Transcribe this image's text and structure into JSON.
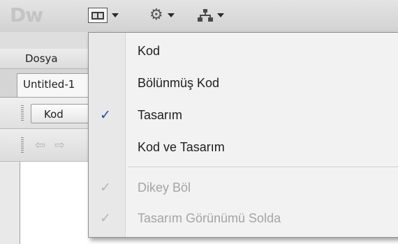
{
  "app": {
    "logo": "Dw"
  },
  "menubar": {
    "file": "Dosya"
  },
  "document": {
    "tab_title": "Untitled-1"
  },
  "doc_toolbar": {
    "code_label": "Kod"
  },
  "nav": {
    "back_icon": "left-arrow-icon",
    "forward_icon": "right-arrow-icon"
  },
  "toolbar": {
    "layout_icon": "layout-split-icon",
    "gear_icon": "gear-icon",
    "site_icon": "sitemap-icon"
  },
  "view_menu": {
    "items": [
      {
        "label": "Kod",
        "checked": false,
        "enabled": true
      },
      {
        "label": "Bölünmüş Kod",
        "checked": false,
        "enabled": true
      },
      {
        "label": "Tasarım",
        "checked": true,
        "enabled": true
      },
      {
        "label": "Kod ve Tasarım",
        "checked": false,
        "enabled": true
      },
      {
        "label": "Dikey Böl",
        "checked": true,
        "enabled": false
      },
      {
        "label": "Tasarım Görünümü Solda",
        "checked": true,
        "enabled": false
      }
    ],
    "check_mark": "✓"
  },
  "colors": {
    "check_active": "#1c4fa6",
    "disabled_text": "#a4a4a4"
  }
}
